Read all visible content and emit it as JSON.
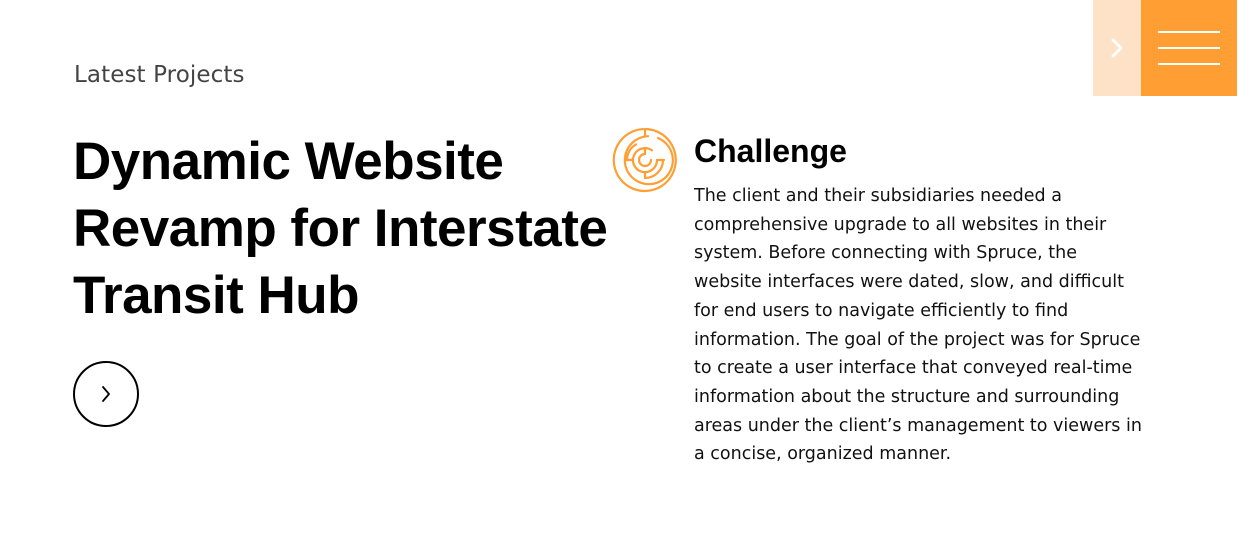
{
  "section": {
    "eyebrow": "Latest Projects"
  },
  "project": {
    "title_line1": "Dynamic Website",
    "title_line2": "Revamp for Interstate",
    "title_line3": "Transit Hub",
    "next_button_icon": "chevron-right-icon"
  },
  "challenge": {
    "icon": "maze-icon",
    "heading": "Challenge",
    "body": "The client and their subsidiaries needed a comprehensive upgrade to all websites in their system. Before connecting with Spruce, the website interfaces were dated, slow, and difficult for end users to navigate efficiently to find information. The goal of the project was for Spruce to create a user interface that conveyed real-time information about the structure and surrounding areas under the client’s management to viewers in a concise, organized manner."
  },
  "top_nav": {
    "next_icon": "chevron-right-icon",
    "menu_icon": "hamburger-menu-icon"
  },
  "colors": {
    "accent": "#ff9e33",
    "accent_light": "#fde2c7",
    "text": "#000000"
  }
}
